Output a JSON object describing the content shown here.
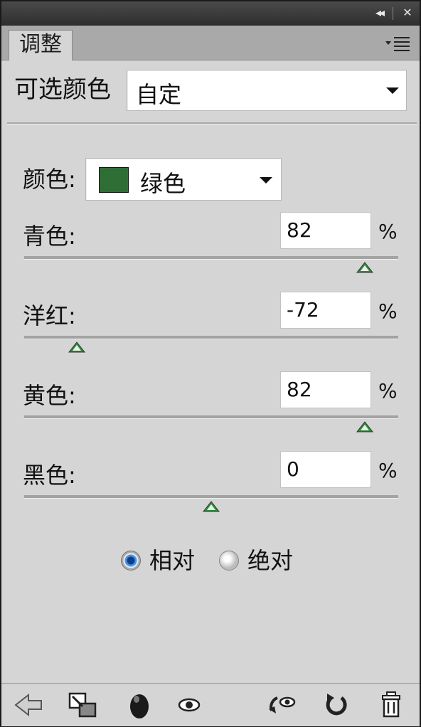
{
  "titlebar": {
    "collapse_icon": "double-left-arrow-icon",
    "close_icon": "close-icon"
  },
  "tab": {
    "label": "调整",
    "menu_icon": "panel-menu-icon"
  },
  "preset": {
    "label": "可选颜色",
    "value": "自定"
  },
  "color_row": {
    "label": "颜色:",
    "value": "绿色",
    "swatch_color": "#2f6f35"
  },
  "sliders": [
    {
      "label": "青色:",
      "value": "82",
      "unit": "%",
      "position_fraction": 0.91
    },
    {
      "label": "洋红:",
      "value": "-72",
      "unit": "%",
      "position_fraction": 0.14
    },
    {
      "label": "黄色:",
      "value": "82",
      "unit": "%",
      "position_fraction": 0.91
    },
    {
      "label": "黑色:",
      "value": "0",
      "unit": "%",
      "position_fraction": 0.5
    }
  ],
  "mode": {
    "options": [
      {
        "label": "相对",
        "selected": true
      },
      {
        "label": "绝对",
        "selected": false
      }
    ]
  },
  "footer_icons": [
    "back-arrow-icon",
    "clip-to-layer-icon",
    "visibility-mask-icon",
    "eye-icon",
    "view-previous-state-icon",
    "reset-icon",
    "trash-icon"
  ],
  "colors": {
    "panel_bg": "#d5d5d5",
    "accent": "#4a90e2",
    "thumb_green": "#2e8b3a"
  }
}
